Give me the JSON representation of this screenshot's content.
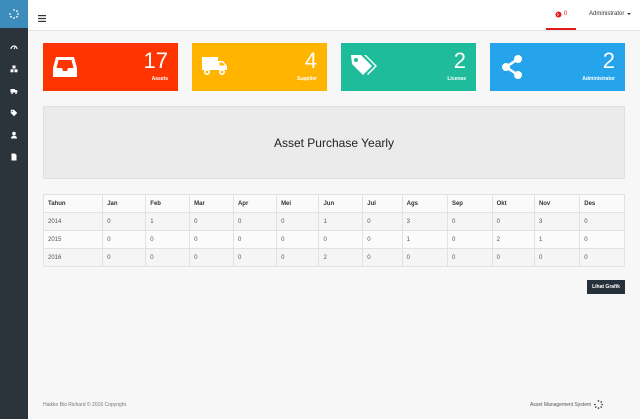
{
  "header": {
    "notification_count": "0",
    "user_name": "Administrator"
  },
  "cards": {
    "assets": {
      "value": "17",
      "label": "Assets",
      "color": "#fe3500",
      "icon": "inbox-tray-icon"
    },
    "supplier": {
      "value": "4",
      "label": "Supplier",
      "color": "#ffb400",
      "icon": "truck-icon"
    },
    "license": {
      "value": "2",
      "label": "License",
      "color": "#1fbc9b",
      "icon": "tags-icon"
    },
    "admin": {
      "value": "2",
      "label": "Administrator",
      "color": "#25a4ec",
      "icon": "share-icon"
    }
  },
  "chart": {
    "title": "Asset Purchase Yearly"
  },
  "table": {
    "headers": [
      "Tahun",
      "Jan",
      "Feb",
      "Mar",
      "Apr",
      "Mei",
      "Jun",
      "Jul",
      "Ags",
      "Sep",
      "Okt",
      "Nov",
      "Des"
    ],
    "rows": [
      [
        "2014",
        "0",
        "1",
        "0",
        "0",
        "0",
        "1",
        "0",
        "3",
        "0",
        "0",
        "3",
        "0"
      ],
      [
        "2015",
        "0",
        "0",
        "0",
        "0",
        "0",
        "0",
        "0",
        "1",
        "0",
        "2",
        "1",
        "0"
      ],
      [
        "2016",
        "0",
        "0",
        "0",
        "0",
        "0",
        "2",
        "0",
        "0",
        "0",
        "0",
        "0",
        "0"
      ]
    ]
  },
  "actions": {
    "view_chart_label": "Lihat Grafik"
  },
  "footer": {
    "copyright": "Haikko Bio Richard © 2016 Copyright.",
    "app_name": "Asset Management System"
  },
  "sidebar": {
    "icons": [
      "dashboard-icon",
      "cubes-icon",
      "truck-icon",
      "tag-icon",
      "user-icon",
      "file-icon"
    ]
  }
}
